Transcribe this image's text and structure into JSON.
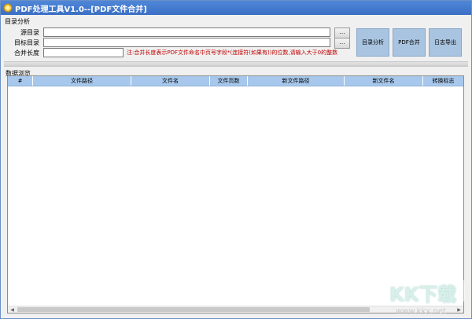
{
  "window": {
    "title": "PDF处理工具V1.0--[PDF文件合并]"
  },
  "analysis_group": {
    "title": "目录分析",
    "source_label": "源目录",
    "target_label": "目标目录",
    "merge_length_label": "合并长度",
    "source_value": "",
    "target_value": "",
    "merge_length_value": "",
    "browse_label": "...",
    "note": "注:合并长度表示PDF文件命名中页号字段*(连接符(如果有))的位数,请输入大于0的整数"
  },
  "buttons": {
    "analyze": "目录分析",
    "merge": "PDF合并",
    "export_log": "日志导出"
  },
  "data_group": {
    "title": "数据浏览",
    "columns": [
      "#",
      "文件路径",
      "文件名",
      "文件页数",
      "新文件路径",
      "新文件名",
      "转换标志"
    ]
  },
  "watermark": {
    "brand": "KK下载",
    "url": "www.kkx.net"
  },
  "colors": {
    "titlebar": "#3b6fc4",
    "header": "#a7c8ec",
    "button": "#a9c4e0",
    "note": "#c00000"
  }
}
